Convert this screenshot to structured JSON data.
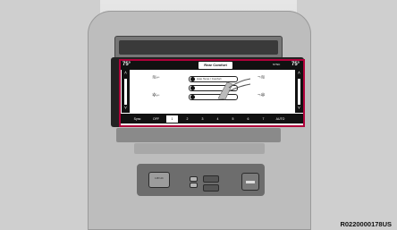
{
  "screen": {
    "left_temp": "75°",
    "right_temp": "75°",
    "title": "Rear Comfort",
    "sync_label": "SYNC",
    "modes": [
      "Auto Temp / Comfort"
    ],
    "fan_bar": [
      "Sync",
      "OFF",
      "1",
      "2",
      "3",
      "4",
      "5",
      "6",
      "7",
      "AUTO"
    ]
  },
  "ports": {
    "outlet_label": "115V AC"
  },
  "figure": {
    "code": "R0220000178US"
  }
}
